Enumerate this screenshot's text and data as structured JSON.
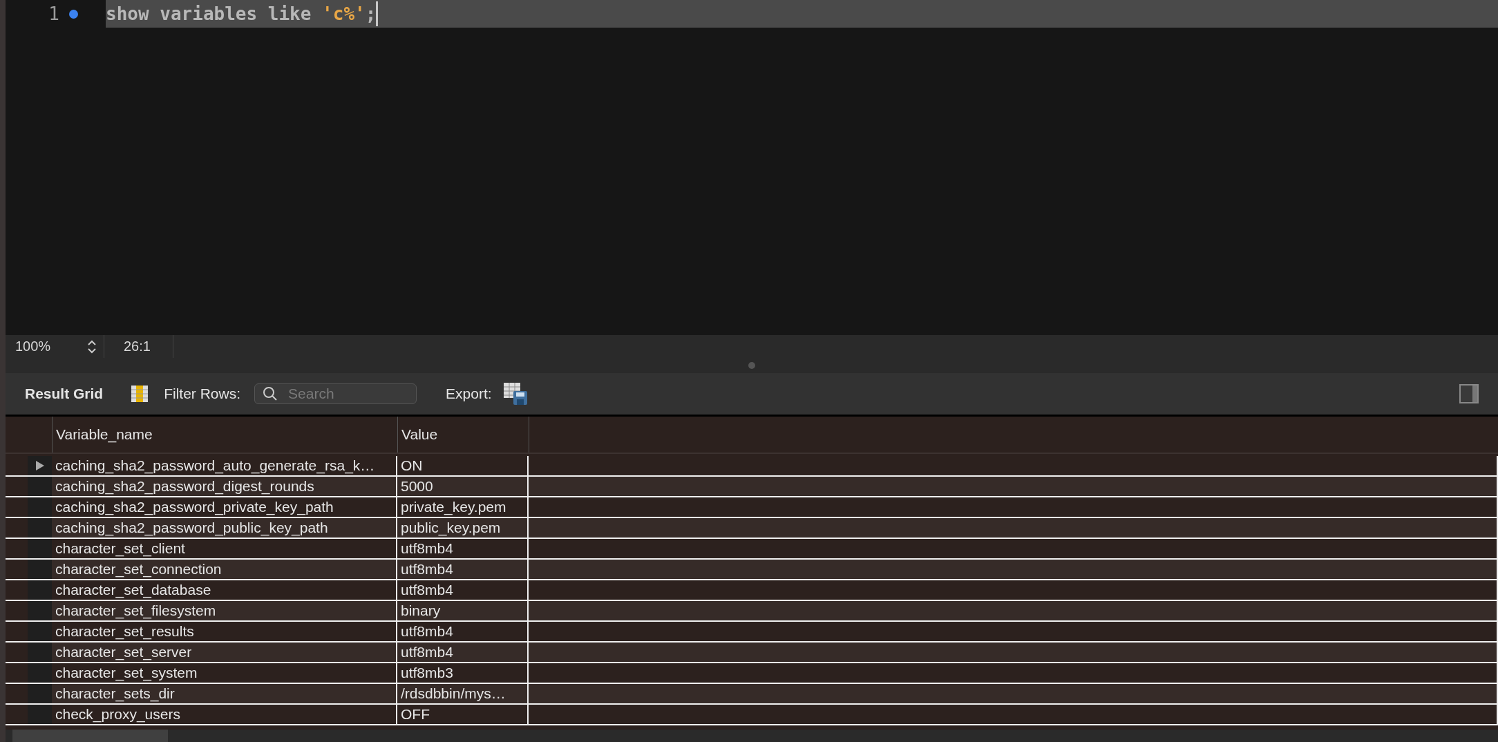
{
  "editor": {
    "lines": [
      {
        "number": "1",
        "parts": [
          {
            "kind": "keyword",
            "text": "show variables like "
          },
          {
            "kind": "string",
            "text": "'c%'"
          },
          {
            "kind": "keyword",
            "text": ";"
          }
        ]
      }
    ]
  },
  "status_bar": {
    "zoom": "100%",
    "position": "26:1"
  },
  "toolbar": {
    "title": "Result Grid",
    "filter_label": "Filter Rows:",
    "search": {
      "placeholder": "Search"
    },
    "export_label": "Export:"
  },
  "table": {
    "columns": [
      "Variable_name",
      "Value"
    ],
    "rows": [
      {
        "cells": [
          "caching_sha2_password_auto_generate_rsa_k…",
          "ON"
        ],
        "selected": true
      },
      {
        "cells": [
          "caching_sha2_password_digest_rounds",
          "5000"
        ],
        "selected": false
      },
      {
        "cells": [
          "caching_sha2_password_private_key_path",
          "private_key.pem"
        ],
        "selected": false
      },
      {
        "cells": [
          "caching_sha2_password_public_key_path",
          "public_key.pem"
        ],
        "selected": false
      },
      {
        "cells": [
          "character_set_client",
          "utf8mb4"
        ],
        "selected": false
      },
      {
        "cells": [
          "character_set_connection",
          "utf8mb4"
        ],
        "selected": false
      },
      {
        "cells": [
          "character_set_database",
          "utf8mb4"
        ],
        "selected": false
      },
      {
        "cells": [
          "character_set_filesystem",
          "binary"
        ],
        "selected": false
      },
      {
        "cells": [
          "character_set_results",
          "utf8mb4"
        ],
        "selected": false
      },
      {
        "cells": [
          "character_set_server",
          "utf8mb4"
        ],
        "selected": false
      },
      {
        "cells": [
          "character_set_system",
          "utf8mb3"
        ],
        "selected": false
      },
      {
        "cells": [
          "character_sets_dir",
          "/rdsdbbin/mys…"
        ],
        "selected": false
      },
      {
        "cells": [
          "check_proxy_users",
          "OFF"
        ],
        "selected": false
      }
    ]
  }
}
